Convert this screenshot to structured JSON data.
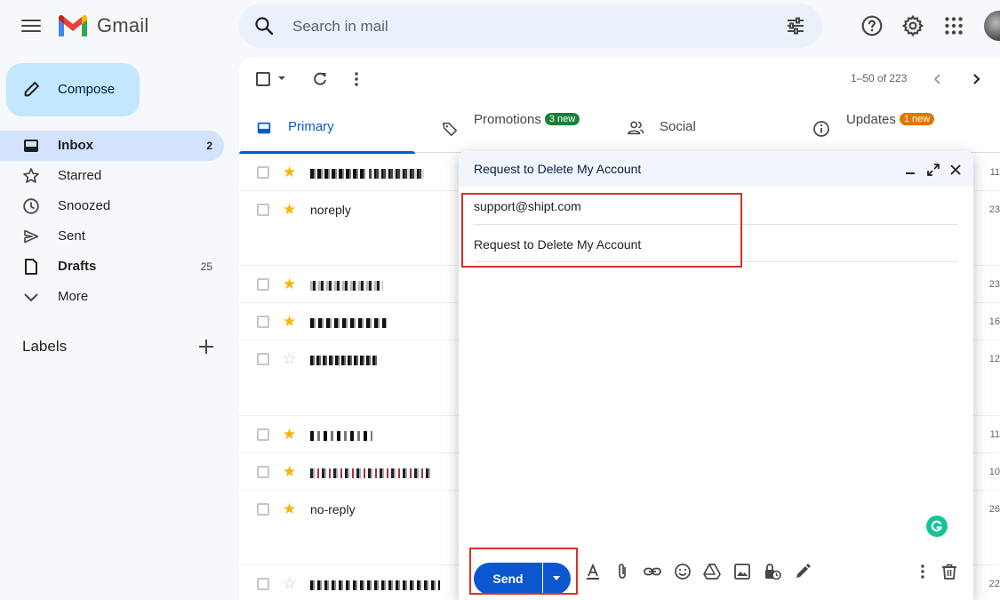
{
  "app": {
    "name": "Gmail"
  },
  "search": {
    "placeholder": "Search in mail"
  },
  "sidebar": {
    "compose_label": "Compose",
    "items": [
      {
        "label": "Inbox",
        "count": "2"
      },
      {
        "label": "Starred",
        "count": ""
      },
      {
        "label": "Snoozed",
        "count": ""
      },
      {
        "label": "Sent",
        "count": ""
      },
      {
        "label": "Drafts",
        "count": "25"
      },
      {
        "label": "More",
        "count": ""
      }
    ],
    "labels_heading": "Labels"
  },
  "toolbar": {
    "pagination": "1–50 of 223"
  },
  "tabs": [
    {
      "label": "Primary",
      "badge": ""
    },
    {
      "label": "Promotions",
      "badge": "3 new",
      "badge_color": "#188038"
    },
    {
      "label": "Social",
      "badge": ""
    },
    {
      "label": "Updates",
      "badge": "1 new",
      "badge_color": "#e37400"
    }
  ],
  "emails": [
    {
      "sender": "",
      "sender_obscured": true,
      "starred": true,
      "date": "11"
    },
    {
      "sender": "noreply",
      "sender_obscured": false,
      "starred": true,
      "date": "23"
    },
    {
      "sender": "",
      "sender_obscured": true,
      "starred": true,
      "date": "23"
    },
    {
      "sender": "",
      "sender_obscured": true,
      "starred": true,
      "date": "16"
    },
    {
      "sender": "",
      "sender_obscured": true,
      "starred": false,
      "date": "12"
    },
    {
      "sender": "",
      "sender_obscured": true,
      "starred": true,
      "date": "11"
    },
    {
      "sender": "",
      "sender_obscured": true,
      "starred": true,
      "date": "10"
    },
    {
      "sender": "no-reply",
      "sender_obscured": false,
      "starred": true,
      "date": "26"
    },
    {
      "sender": "",
      "sender_obscured": true,
      "starred": false,
      "date": "22"
    }
  ],
  "composer": {
    "title": "Request to Delete My Account",
    "to": "support@shipt.com",
    "subject": "Request to Delete My Account",
    "send_label": "Send"
  },
  "colors": {
    "accent": "#0b57d0",
    "highlight_box": "#d93025",
    "star": "#f4b400"
  }
}
